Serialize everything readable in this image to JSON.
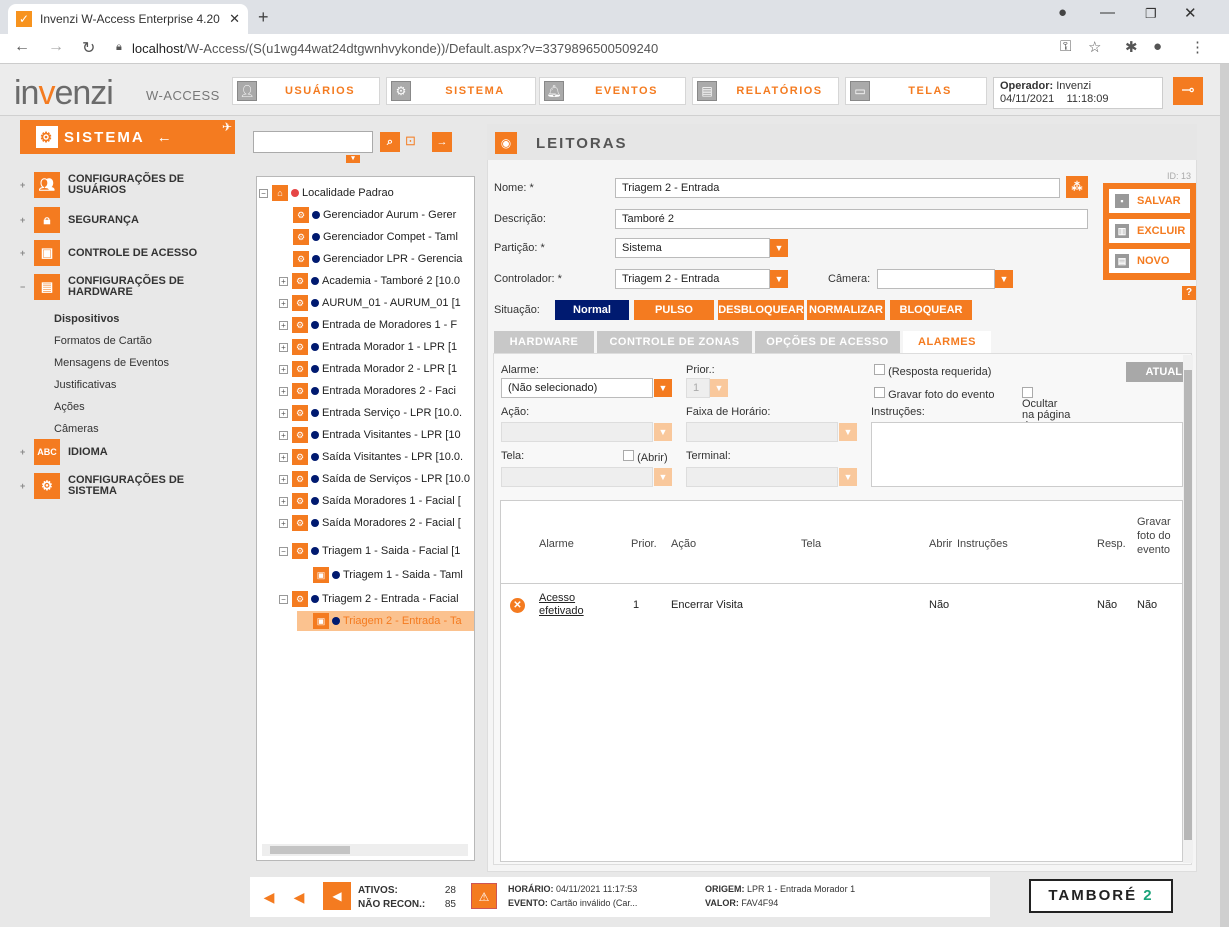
{
  "browser": {
    "tab_title": "Invenzi W-Access Enterprise 4.20",
    "url_host": "localhost",
    "url_path": "/W-Access/(S(u1wg44wat24dtgwnhvykonde))/Default.aspx?v=3379896500509240"
  },
  "app": {
    "logo_main": "in",
    "logo_v": "v",
    "logo_rest": "enzi",
    "logo_sub": "W-ACCESS"
  },
  "menu": [
    {
      "label": "USUÁRIOS"
    },
    {
      "label": "SISTEMA"
    },
    {
      "label": "EVENTOS"
    },
    {
      "label": "RELATÓRIOS"
    },
    {
      "label": "TELAS"
    }
  ],
  "operator": {
    "label": "Operador:",
    "name": "Invenzi",
    "date": "04/11/2021",
    "time": "11:18:09"
  },
  "sidebar": {
    "title": "SISTEMA",
    "items": [
      {
        "label1": "CONFIGURAÇÕES DE",
        "label2": "USUÁRIOS"
      },
      {
        "label1": "SEGURANÇA",
        "label2": ""
      },
      {
        "label1": "CONTROLE DE ACESSO",
        "label2": ""
      },
      {
        "label1": "CONFIGURAÇÕES DE",
        "label2": "HARDWARE"
      },
      {
        "label1": "IDIOMA",
        "label2": ""
      },
      {
        "label1": "CONFIGURAÇÕES DE",
        "label2": "SISTEMA"
      }
    ],
    "subitems": [
      "Dispositivos",
      "Formatos de Cartão",
      "Mensagens de Eventos",
      "Justificativas",
      "Ações",
      "Câmeras"
    ]
  },
  "tree": {
    "root": "Localidade Padrao",
    "nodes": [
      "Gerenciador Aurum - Gerer",
      "Gerenciador Compet - Taml",
      "Gerenciador LPR - Gerencia",
      "Academia - Tamboré 2 [10.0",
      "AURUM_01 - AURUM_01 [1",
      "Entrada de Moradores 1 - F",
      "Entrada Morador 1 - LPR [1",
      "Entrada Morador 2 - LPR [1",
      "Entrada Moradores 2 - Faci",
      "Entrada Serviço - LPR [10.0.",
      "Entrada Visitantes - LPR [10",
      "Saída Visitantes - LPR [10.0.",
      "Saída de Serviços - LPR [10.0",
      "Saída Moradores 1 - Facial [",
      "Saída Moradores 2 - Facial [",
      "Triagem 1 - Saida - Facial [1",
      "Triagem 1 - Saida - Taml",
      "Triagem 2 - Entrada - Facial",
      "Triagem 2 - Entrada - Ta"
    ]
  },
  "page": {
    "title": "LEITORAS",
    "id": "ID: 13"
  },
  "form": {
    "nome_label": "Nome: *",
    "nome": "Triagem 2 - Entrada",
    "desc_label": "Descrição:",
    "desc": "Tamboré 2",
    "part_label": "Partição: *",
    "part": "Sistema",
    "ctrl_label": "Controlador: *",
    "ctrl": "Triagem 2 - Entrada",
    "cam_label": "Câmera:",
    "cam": "",
    "sit_label": "Situação:"
  },
  "situacao": [
    "Normal",
    "PULSO",
    "DESBLOQUEAR",
    "NORMALIZAR",
    "BLOQUEAR"
  ],
  "actions": {
    "save": "SALVAR",
    "delete": "EXCLUIR",
    "new": "NOVO",
    "help": "?"
  },
  "tabs": [
    "HARDWARE",
    "CONTROLE DE ZONAS",
    "OPÇÕES DE ACESSO",
    "ALARMES"
  ],
  "alarm": {
    "alarme_label": "Alarme:",
    "alarme": "(Não selecionado)",
    "prior_label": "Prior.:",
    "prior": "1",
    "resp": "(Resposta requerida)",
    "foto": "Gravar foto do evento",
    "ocultar": "Ocultar na página de eventos",
    "atual": "ATUAL",
    "acao_label": "Ação:",
    "faixa_label": "Faixa de Horário:",
    "instr_label": "Instruções:",
    "tela_label": "Tela:",
    "abrir": "(Abrir)",
    "terminal_label": "Terminal:"
  },
  "grid": {
    "headers": [
      "Alarme",
      "Prior.",
      "Ação",
      "Tela",
      "Abrir",
      "Instruções",
      "Resp.",
      "Gravar foto do evento"
    ],
    "rows": [
      {
        "alarme": "Acesso efetivado",
        "prior": "1",
        "acao": "Encerrar Visita",
        "tela": "",
        "abrir": "Não",
        "instr": "",
        "resp": "Não",
        "foto": "Não"
      }
    ]
  },
  "footer": {
    "ativos_label": "ATIVOS:",
    "ativos": "28",
    "naorecon_label": "NÃO RECON.:",
    "naorecon": "85",
    "horario_label": "HORÁRIO:",
    "horario": "04/11/2021 11:17:53",
    "evento_label": "EVENTO:",
    "evento": "Cartão inválido (Car...",
    "origem_label": "ORIGEM:",
    "origem": "LPR 1 - Entrada Morador 1",
    "valor_label": "VALOR:",
    "valor": "FAV4F94",
    "brand1": "TAMBORÉ",
    "brand2": "2"
  },
  "colors": {
    "accent": "#f47b20",
    "navy": "#001a70"
  }
}
